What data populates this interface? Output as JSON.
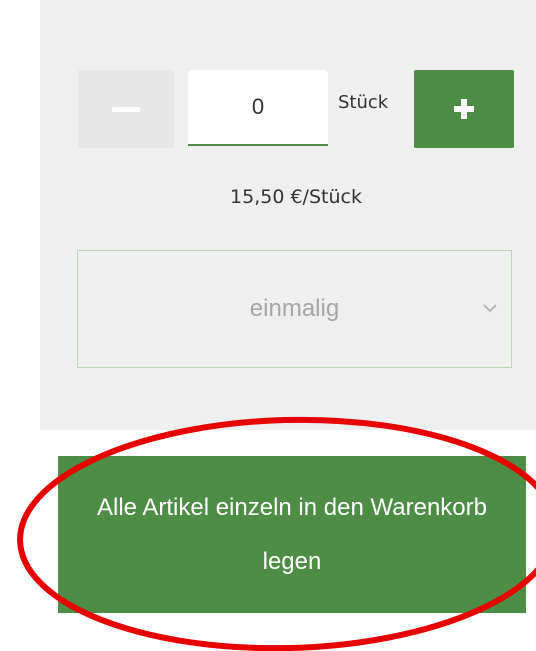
{
  "quantity": {
    "value": "0",
    "unit": "Stück",
    "minus_icon": "minus-icon",
    "plus_icon": "plus-icon"
  },
  "price": {
    "text": "15,50 €/Stück"
  },
  "frequency_select": {
    "selected": "einmalig",
    "icon": "chevron-down-icon"
  },
  "cart_button": {
    "label": "Alle Artikel einzeln in den Warenkorb legen"
  },
  "colors": {
    "accent_green": "#4e8d46",
    "panel_bg": "#efefef",
    "annotation_red": "#e60000"
  }
}
